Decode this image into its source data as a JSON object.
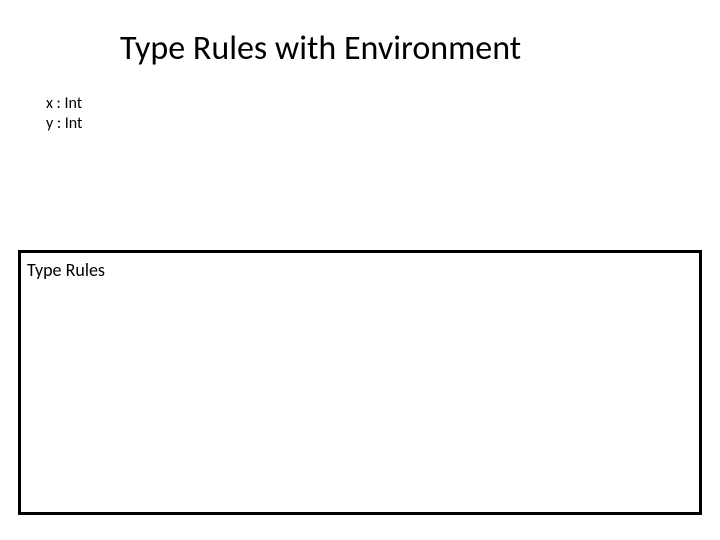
{
  "title": "Type Rules with Environment",
  "env": {
    "line1": "x : Int",
    "line2": "y : Int"
  },
  "rules_box": {
    "label": "Type Rules"
  }
}
